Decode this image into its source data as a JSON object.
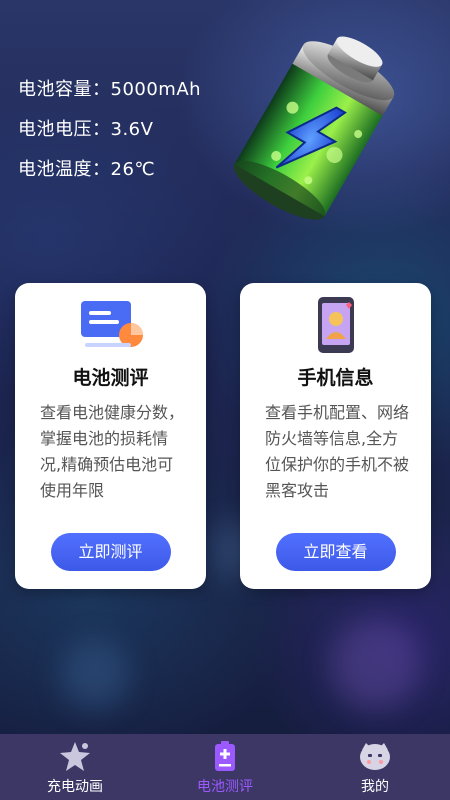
{
  "specs": {
    "capacity": "电池容量：5000mAh",
    "voltage": "电池电压：3.6V",
    "temperature": "电池温度：26℃"
  },
  "cards": [
    {
      "title": "电池测评",
      "description": "查看电池健康分数，掌握电池的损耗情况,精确预估电池可使用年限",
      "button": "立即测评",
      "icon": "battery-report-icon"
    },
    {
      "title": "手机信息",
      "description": "查看手机配置、网络防火墙等信息,全方位保护你的手机不被黑客攻击",
      "button": "立即查看",
      "icon": "phone-info-icon"
    }
  ],
  "tabbar": {
    "items": [
      {
        "label": "充电动画",
        "icon": "star-icon",
        "active": false
      },
      {
        "label": "电池测评",
        "icon": "battery-icon",
        "active": true
      },
      {
        "label": "我的",
        "icon": "face-icon",
        "active": false
      }
    ]
  },
  "colors": {
    "accent": "#9b59ff",
    "button": "#4664f4",
    "tabbar": "#3c3765"
  }
}
